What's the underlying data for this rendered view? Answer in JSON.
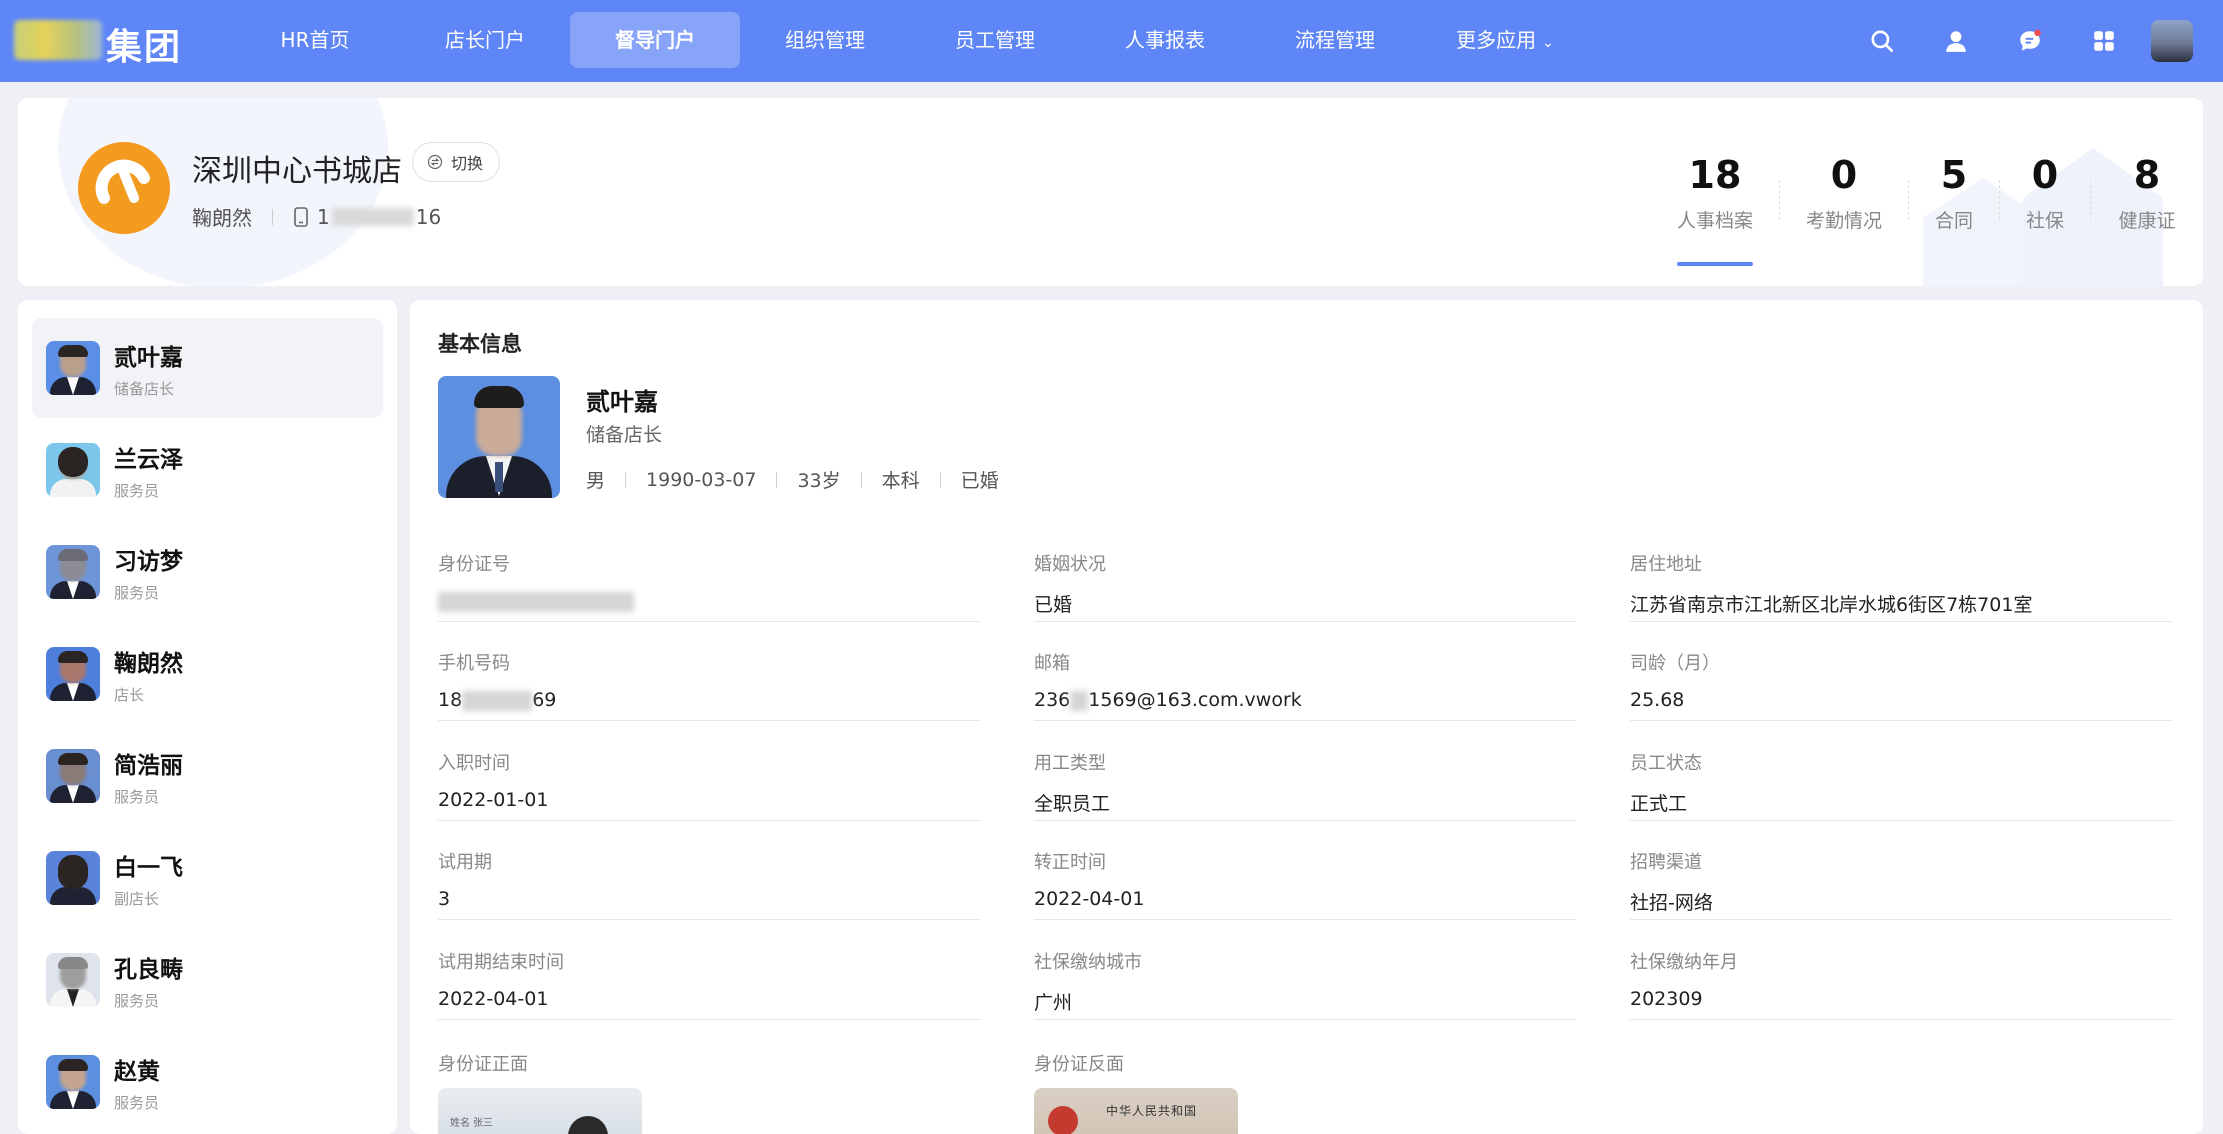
{
  "nav": {
    "logo_text": "集团",
    "items": [
      {
        "label": "HR首页",
        "active": false
      },
      {
        "label": "店长门户",
        "active": false
      },
      {
        "label": "督导门户",
        "active": true
      },
      {
        "label": "组织管理",
        "active": false
      },
      {
        "label": "员工管理",
        "active": false
      },
      {
        "label": "人事报表",
        "active": false
      },
      {
        "label": "流程管理",
        "active": false
      },
      {
        "label": "更多应用",
        "active": false
      }
    ],
    "icons": [
      "search-icon",
      "user-icon",
      "message-icon",
      "apps-grid-icon"
    ]
  },
  "store": {
    "name": "深圳中心书城店",
    "switch_label": "切换",
    "manager_name": "鞠朗然",
    "phone_prefix": "1",
    "phone_suffix": "16",
    "stats": [
      {
        "num": "18",
        "label": "人事档案"
      },
      {
        "num": "0",
        "label": "考勤情况"
      },
      {
        "num": "5",
        "label": "合同"
      },
      {
        "num": "0",
        "label": "社保"
      },
      {
        "num": "8",
        "label": "健康证"
      }
    ]
  },
  "employees": [
    {
      "name": "贰叶嘉",
      "role": "储备店长",
      "active": true
    },
    {
      "name": "兰云泽",
      "role": "服务员"
    },
    {
      "name": "习访梦",
      "role": "服务员"
    },
    {
      "name": "鞠朗然",
      "role": "店长"
    },
    {
      "name": "简浩丽",
      "role": "服务员"
    },
    {
      "name": "白一飞",
      "role": "副店长"
    },
    {
      "name": "孔良畴",
      "role": "服务员"
    },
    {
      "name": "赵黄",
      "role": "服务员"
    }
  ],
  "detail": {
    "section_title": "基本信息",
    "name": "贰叶嘉",
    "role": "储备店长",
    "tags": [
      "男",
      "1990-03-07",
      "33岁",
      "本科",
      "已婚"
    ],
    "fields": [
      {
        "label": "身份证号",
        "value": ""
      },
      {
        "label": "婚姻状况",
        "value": "已婚"
      },
      {
        "label": "居住地址",
        "value": "江苏省南京市江北新区北岸水城6街区7栋701室"
      },
      {
        "label": "手机号码",
        "value_prefix": "18",
        "value_suffix": "69"
      },
      {
        "label": "邮箱",
        "value_prefix": "236",
        "value_suffix": "1569@163.com.vwork"
      },
      {
        "label": "司龄（月）",
        "value": "25.68"
      },
      {
        "label": "入职时间",
        "value": "2022-01-01"
      },
      {
        "label": "用工类型",
        "value": "全职员工"
      },
      {
        "label": "员工状态",
        "value": "正式工"
      },
      {
        "label": "试用期",
        "value": "3"
      },
      {
        "label": "转正时间",
        "value": "2022-04-01"
      },
      {
        "label": "招聘渠道",
        "value": "社招-网络"
      },
      {
        "label": "试用期结束时间",
        "value": "2022-04-01"
      },
      {
        "label": "社保缴纳城市",
        "value": "广州"
      },
      {
        "label": "社保缴纳年月",
        "value": "202309"
      }
    ],
    "id_front_label": "身份证正面",
    "id_back_label": "身份证反面",
    "id_front_text": "姓名 张三",
    "id_back_text": "中华人民共和国"
  },
  "colors": {
    "primary": "#5f86f6",
    "page_bg": "#eef0f5",
    "store_logo": "#f39b1f"
  }
}
